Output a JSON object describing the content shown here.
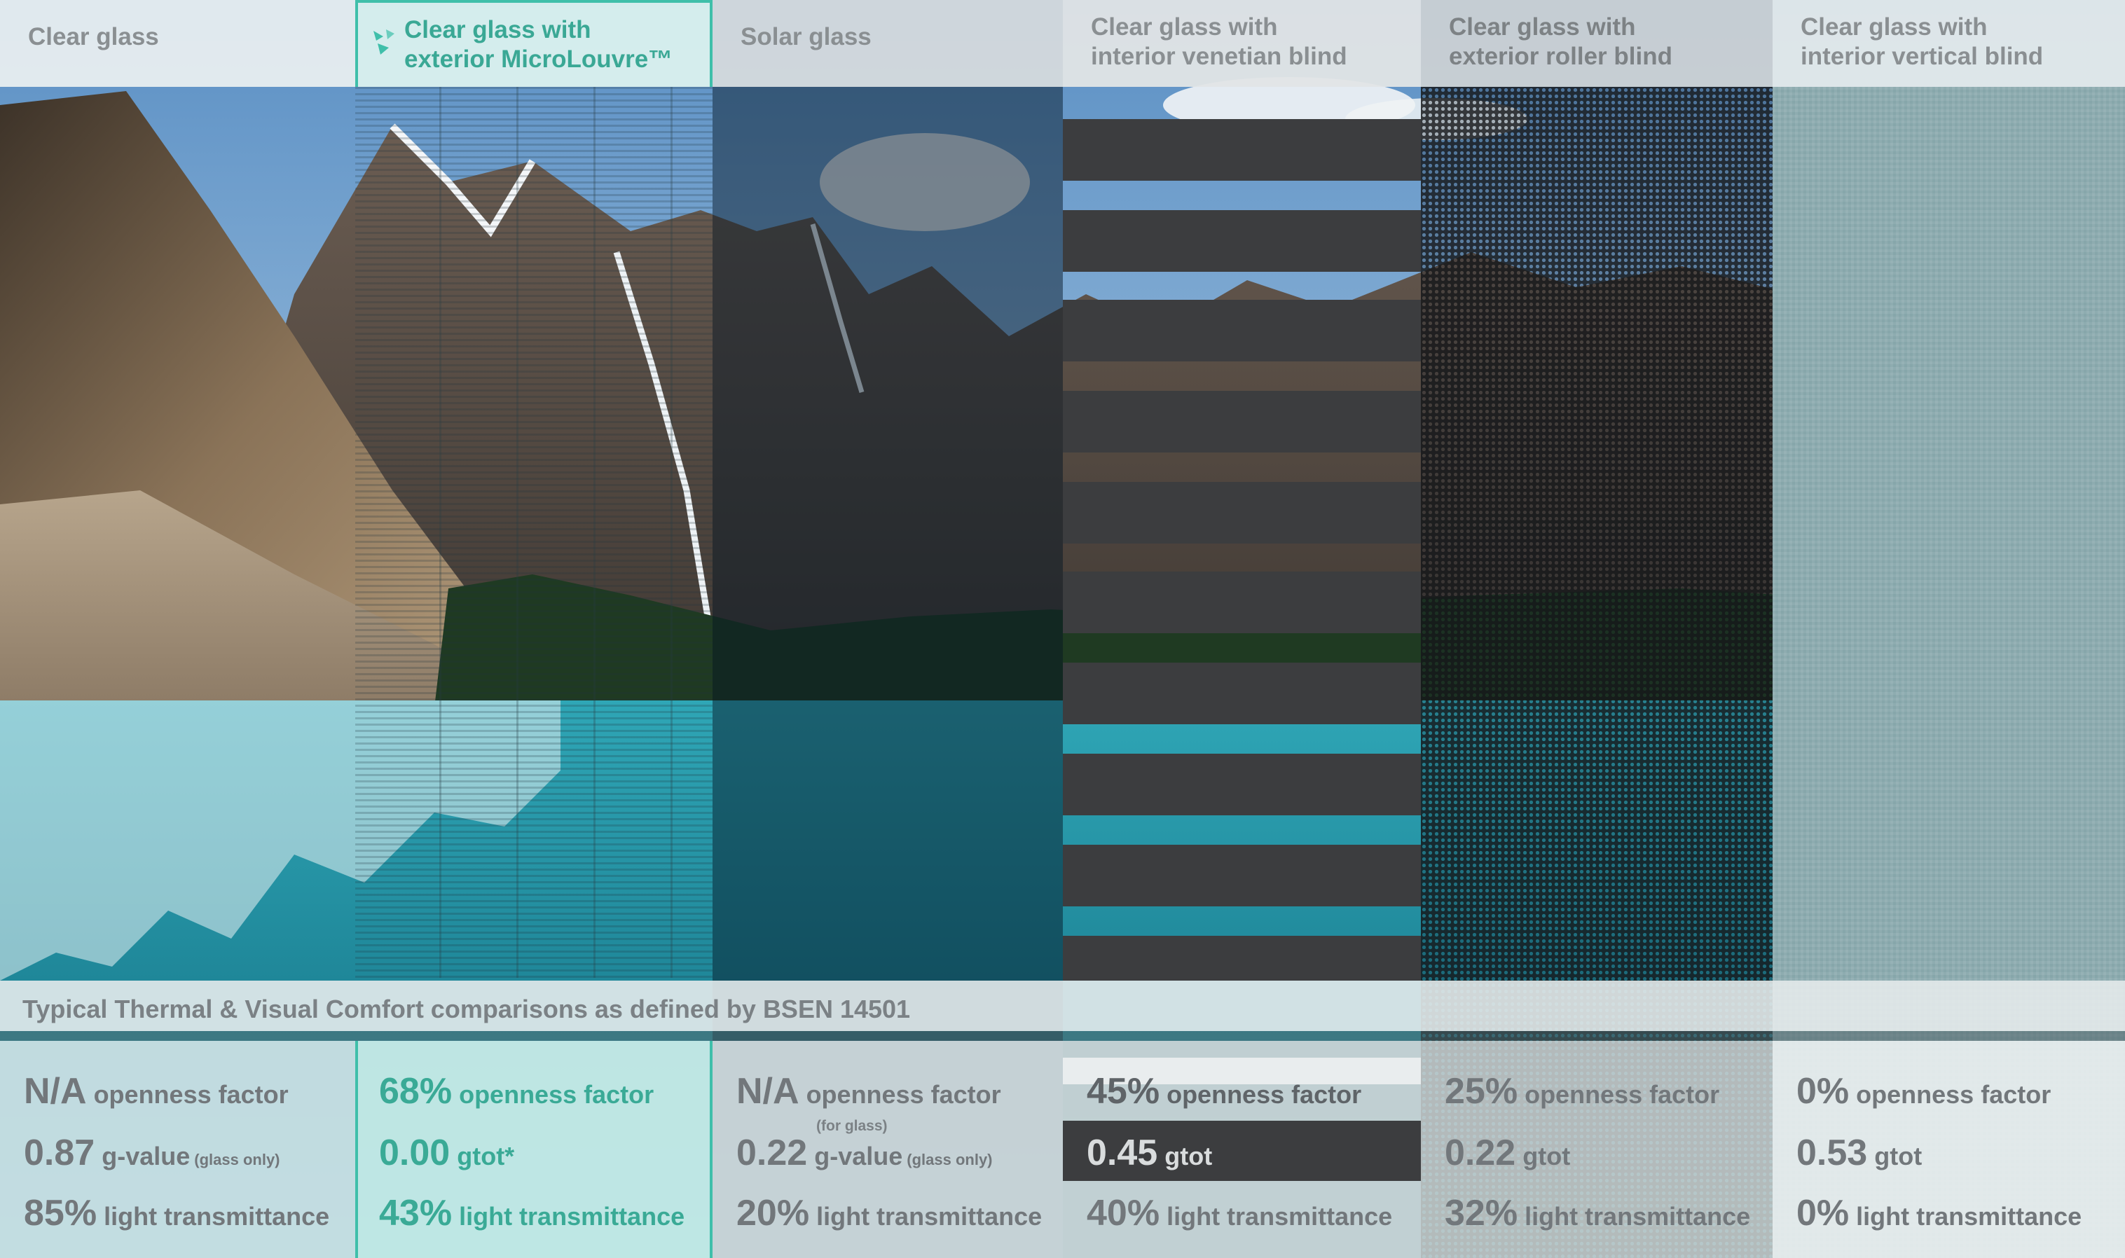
{
  "band_title": "Typical Thermal & Visual Comfort comparisons as defined by BSEN 14501",
  "colors": {
    "accent": "#3fbfaa",
    "text_grey": "#7b8185",
    "slat": "#3c3d3f"
  },
  "panels": [
    {
      "title_lines": [
        "Clear glass"
      ],
      "stats": [
        {
          "value": "N/A",
          "label": "openness factor",
          "sub": ""
        },
        {
          "value": "0.87",
          "label": "g-value",
          "sub": "(glass only)"
        },
        {
          "value": "85%",
          "label": "light transmittance",
          "sub": ""
        }
      ]
    },
    {
      "title_lines": [
        "Clear glass with",
        "exterior MicroLouvre™"
      ],
      "icon": "microlouvre-logo-icon",
      "stats": [
        {
          "value": "68%",
          "label": "openness factor",
          "sub": ""
        },
        {
          "value": "0.00",
          "label": "gtot*",
          "sub": ""
        },
        {
          "value": "43%",
          "label": "light transmittance",
          "sub": ""
        }
      ]
    },
    {
      "title_lines": [
        "Solar glass"
      ],
      "note": "(for glass)",
      "stats": [
        {
          "value": "N/A",
          "label": "openness factor",
          "sub": ""
        },
        {
          "value": "0.22",
          "label": "g-value",
          "sub": "(glass only)"
        },
        {
          "value": "20%",
          "label": "light transmittance",
          "sub": ""
        }
      ]
    },
    {
      "title_lines": [
        "Clear glass with",
        "interior venetian blind"
      ],
      "stats": [
        {
          "value": "45%",
          "label": "openness factor",
          "sub": ""
        },
        {
          "value": "0.45",
          "label": "gtot",
          "sub": ""
        },
        {
          "value": "40%",
          "label": "light transmittance",
          "sub": ""
        }
      ]
    },
    {
      "title_lines": [
        "Clear glass with",
        "exterior roller blind"
      ],
      "stats": [
        {
          "value": "25%",
          "label": "openness factor",
          "sub": ""
        },
        {
          "value": "0.22",
          "label": "gtot",
          "sub": ""
        },
        {
          "value": "32%",
          "label": "light transmittance",
          "sub": ""
        }
      ]
    },
    {
      "title_lines": [
        "Clear glass with",
        "interior vertical blind"
      ],
      "stats": [
        {
          "value": "0%",
          "label": "openness factor",
          "sub": ""
        },
        {
          "value": "0.53",
          "label": "gtot",
          "sub": ""
        },
        {
          "value": "0%",
          "label": "light transmittance",
          "sub": ""
        }
      ]
    }
  ]
}
